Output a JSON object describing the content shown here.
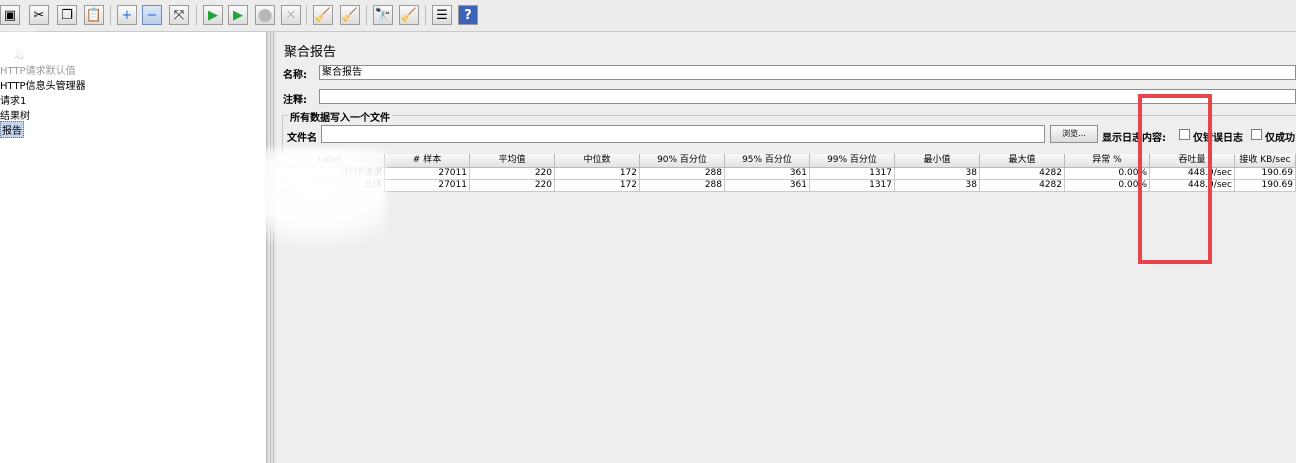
{
  "toolbar": {
    "buttons": [
      {
        "icon": "save-icon",
        "glyph": "▣"
      },
      {
        "icon": "cut-icon",
        "glyph": "✂"
      },
      {
        "icon": "copy-icon",
        "glyph": "❐"
      },
      {
        "icon": "paste-icon",
        "glyph": "📋"
      },
      {
        "icon": "expand-icon",
        "glyph": "+"
      },
      {
        "icon": "collapse-icon",
        "glyph": "−"
      },
      {
        "icon": "toggle-icon",
        "glyph": "⤧"
      },
      {
        "icon": "start-icon",
        "glyph": "▶"
      },
      {
        "icon": "start-no-pause-icon",
        "glyph": "▶"
      },
      {
        "icon": "stop-icon",
        "glyph": "⬤"
      },
      {
        "icon": "shutdown-icon",
        "glyph": "✕"
      },
      {
        "icon": "clear-icon",
        "glyph": "🧹"
      },
      {
        "icon": "clear-all-icon",
        "glyph": "🧹"
      },
      {
        "icon": "search-icon",
        "glyph": "🔭"
      },
      {
        "icon": "reset-search-icon",
        "glyph": "🧹"
      },
      {
        "icon": "function-helper-icon",
        "glyph": "☰"
      },
      {
        "icon": "help-icon",
        "glyph": "?"
      }
    ]
  },
  "tree": {
    "items": [
      {
        "text": "划"
      },
      {
        "text": "HTTP请求默认值"
      },
      {
        "text": "HTTP信息头管理器"
      },
      {
        "text": "请求1"
      },
      {
        "text": "结果树"
      },
      {
        "text": "报告"
      }
    ]
  },
  "panel": {
    "title": "聚合报告",
    "name_label": "名称:",
    "name_value": "聚合报告",
    "comment_label": "注释:",
    "comment_value": "",
    "fieldset_title": "所有数据写入一个文件",
    "filename_label": "文件名",
    "filename_value": "",
    "browse_label": "浏览...",
    "log_label": "显示日志内容:",
    "errors_only_label": "仅错误日志",
    "success_only_label": "仅成功日"
  },
  "table": {
    "headers": [
      "Label",
      "# 样本",
      "平均值",
      "中位数",
      "90% 百分位",
      "95% 百分位",
      "99% 百分位",
      "最小值",
      "最大值",
      "异常 %",
      "吞吐量",
      "接收 KB/sec"
    ],
    "rows": [
      [
        "HTTP请求",
        "27011",
        "220",
        "172",
        "288",
        "361",
        "1317",
        "38",
        "4282",
        "0.00%",
        "448.9/sec",
        "190.69"
      ],
      [
        "总体",
        "27011",
        "220",
        "172",
        "288",
        "361",
        "1317",
        "38",
        "4282",
        "0.00%",
        "448.9/sec",
        "190.69"
      ]
    ]
  },
  "colors": {
    "highlight": "#e8454b",
    "selection": "#c6d5ee"
  }
}
